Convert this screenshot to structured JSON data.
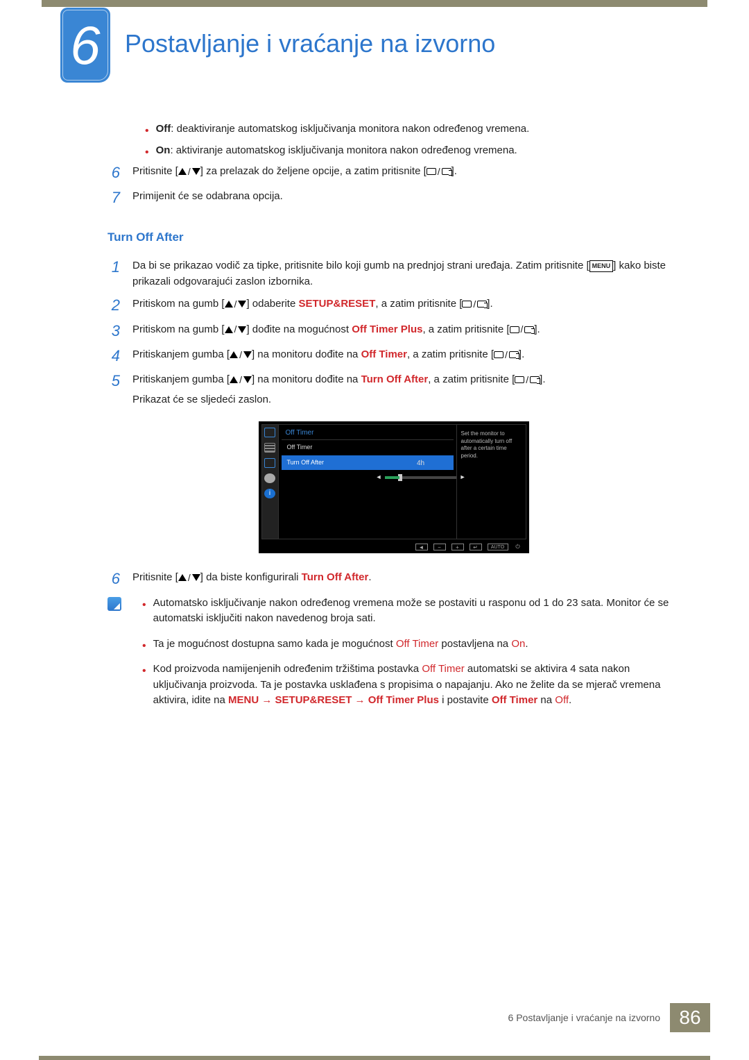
{
  "chapter": {
    "num": "6",
    "title": "Postavljanje i vraćanje na izvorno"
  },
  "intro": {
    "off_label": "Off",
    "off_text": ": deaktiviranje automatskog isključivanja monitora nakon određenog vremena.",
    "on_label": "On",
    "on_text": ": aktiviranje automatskog isključivanja monitora nakon određenog vremena.",
    "step6": "Pritisnite [",
    "step6b": "] za prelazak do željene opcije, a zatim pritisnite [",
    "step6c": "].",
    "step7": "Primijenit će se odabrana opcija."
  },
  "section": {
    "title": "Turn Off After",
    "s1a": "Da bi se prikazao vodič za tipke, pritisnite bilo koji gumb na prednjoj strani uređaja. Zatim pritisnite [",
    "s1_menu": "MENU",
    "s1b": "] kako biste prikazali odgovarajući zaslon izbornika.",
    "s2a": "Pritiskom na gumb [",
    "s2b": "] odaberite ",
    "s2_red": "SETUP&RESET",
    "s2c": ", a zatim pritisnite [",
    "s2d": "].",
    "s3a": "Pritiskom na gumb [",
    "s3b": "] dođite na mogućnost ",
    "s3_red": "Off Timer Plus",
    "s3c": ", a zatim pritisnite [",
    "s3d": "].",
    "s4a": "Pritiskanjem gumba [",
    "s4b": "] na monitoru dođite na ",
    "s4_red": "Off Timer",
    "s4c": ", a zatim pritisnite [",
    "s4d": "].",
    "s5a": "Pritiskanjem gumba [",
    "s5b": "] na monitoru dođite na ",
    "s5_red": "Turn Off After",
    "s5c": ", a zatim pritisnite [",
    "s5d": "].",
    "s5e": "Prikazat će se sljedeći zaslon.",
    "s6a": "Pritisnite [",
    "s6b": "] da biste konfigurirali ",
    "s6_red": "Turn Off After",
    "s6c": "."
  },
  "osd": {
    "title": "Off Timer",
    "item1": "Off Timer",
    "item2": "Turn Off After",
    "value": "4h",
    "desc": "Set the monitor to automatically turn off after a certain time period.",
    "auto": "AUTO"
  },
  "notes": {
    "n1": "Automatsko isključivanje nakon određenog vremena može se postaviti u rasponu od 1 do 23 sata. Monitor će se automatski isključiti nakon navedenog broja sati.",
    "n2a": "Ta je mogućnost dostupna samo kada je mogućnost ",
    "n2_r1": "Off Timer",
    "n2b": " postavljena na ",
    "n2_r2": "On",
    "n2c": ".",
    "n3a": "Kod proizvoda namijenjenih određenim tržištima postavka ",
    "n3_r1": "Off Timer",
    "n3b": " automatski se aktivira 4 sata nakon uključivanja proizvoda. Ta je postavka usklađena s propisima o napajanju. Ako ne želite da se mjerač vremena aktivira, idite na ",
    "n3_r2": "MENU",
    "n3_arrow1": " → ",
    "n3_r3": "SETUP&RESET",
    "n3_arrow2": " → ",
    "n3_r4": "Off Timer Plus",
    "n3c": " i postavite ",
    "n3_r5": "Off Timer",
    "n3d": " na ",
    "n3_r6": "Off",
    "n3e": "."
  },
  "footer": {
    "text": "6 Postavljanje i vraćanje na izvorno",
    "page": "86"
  }
}
